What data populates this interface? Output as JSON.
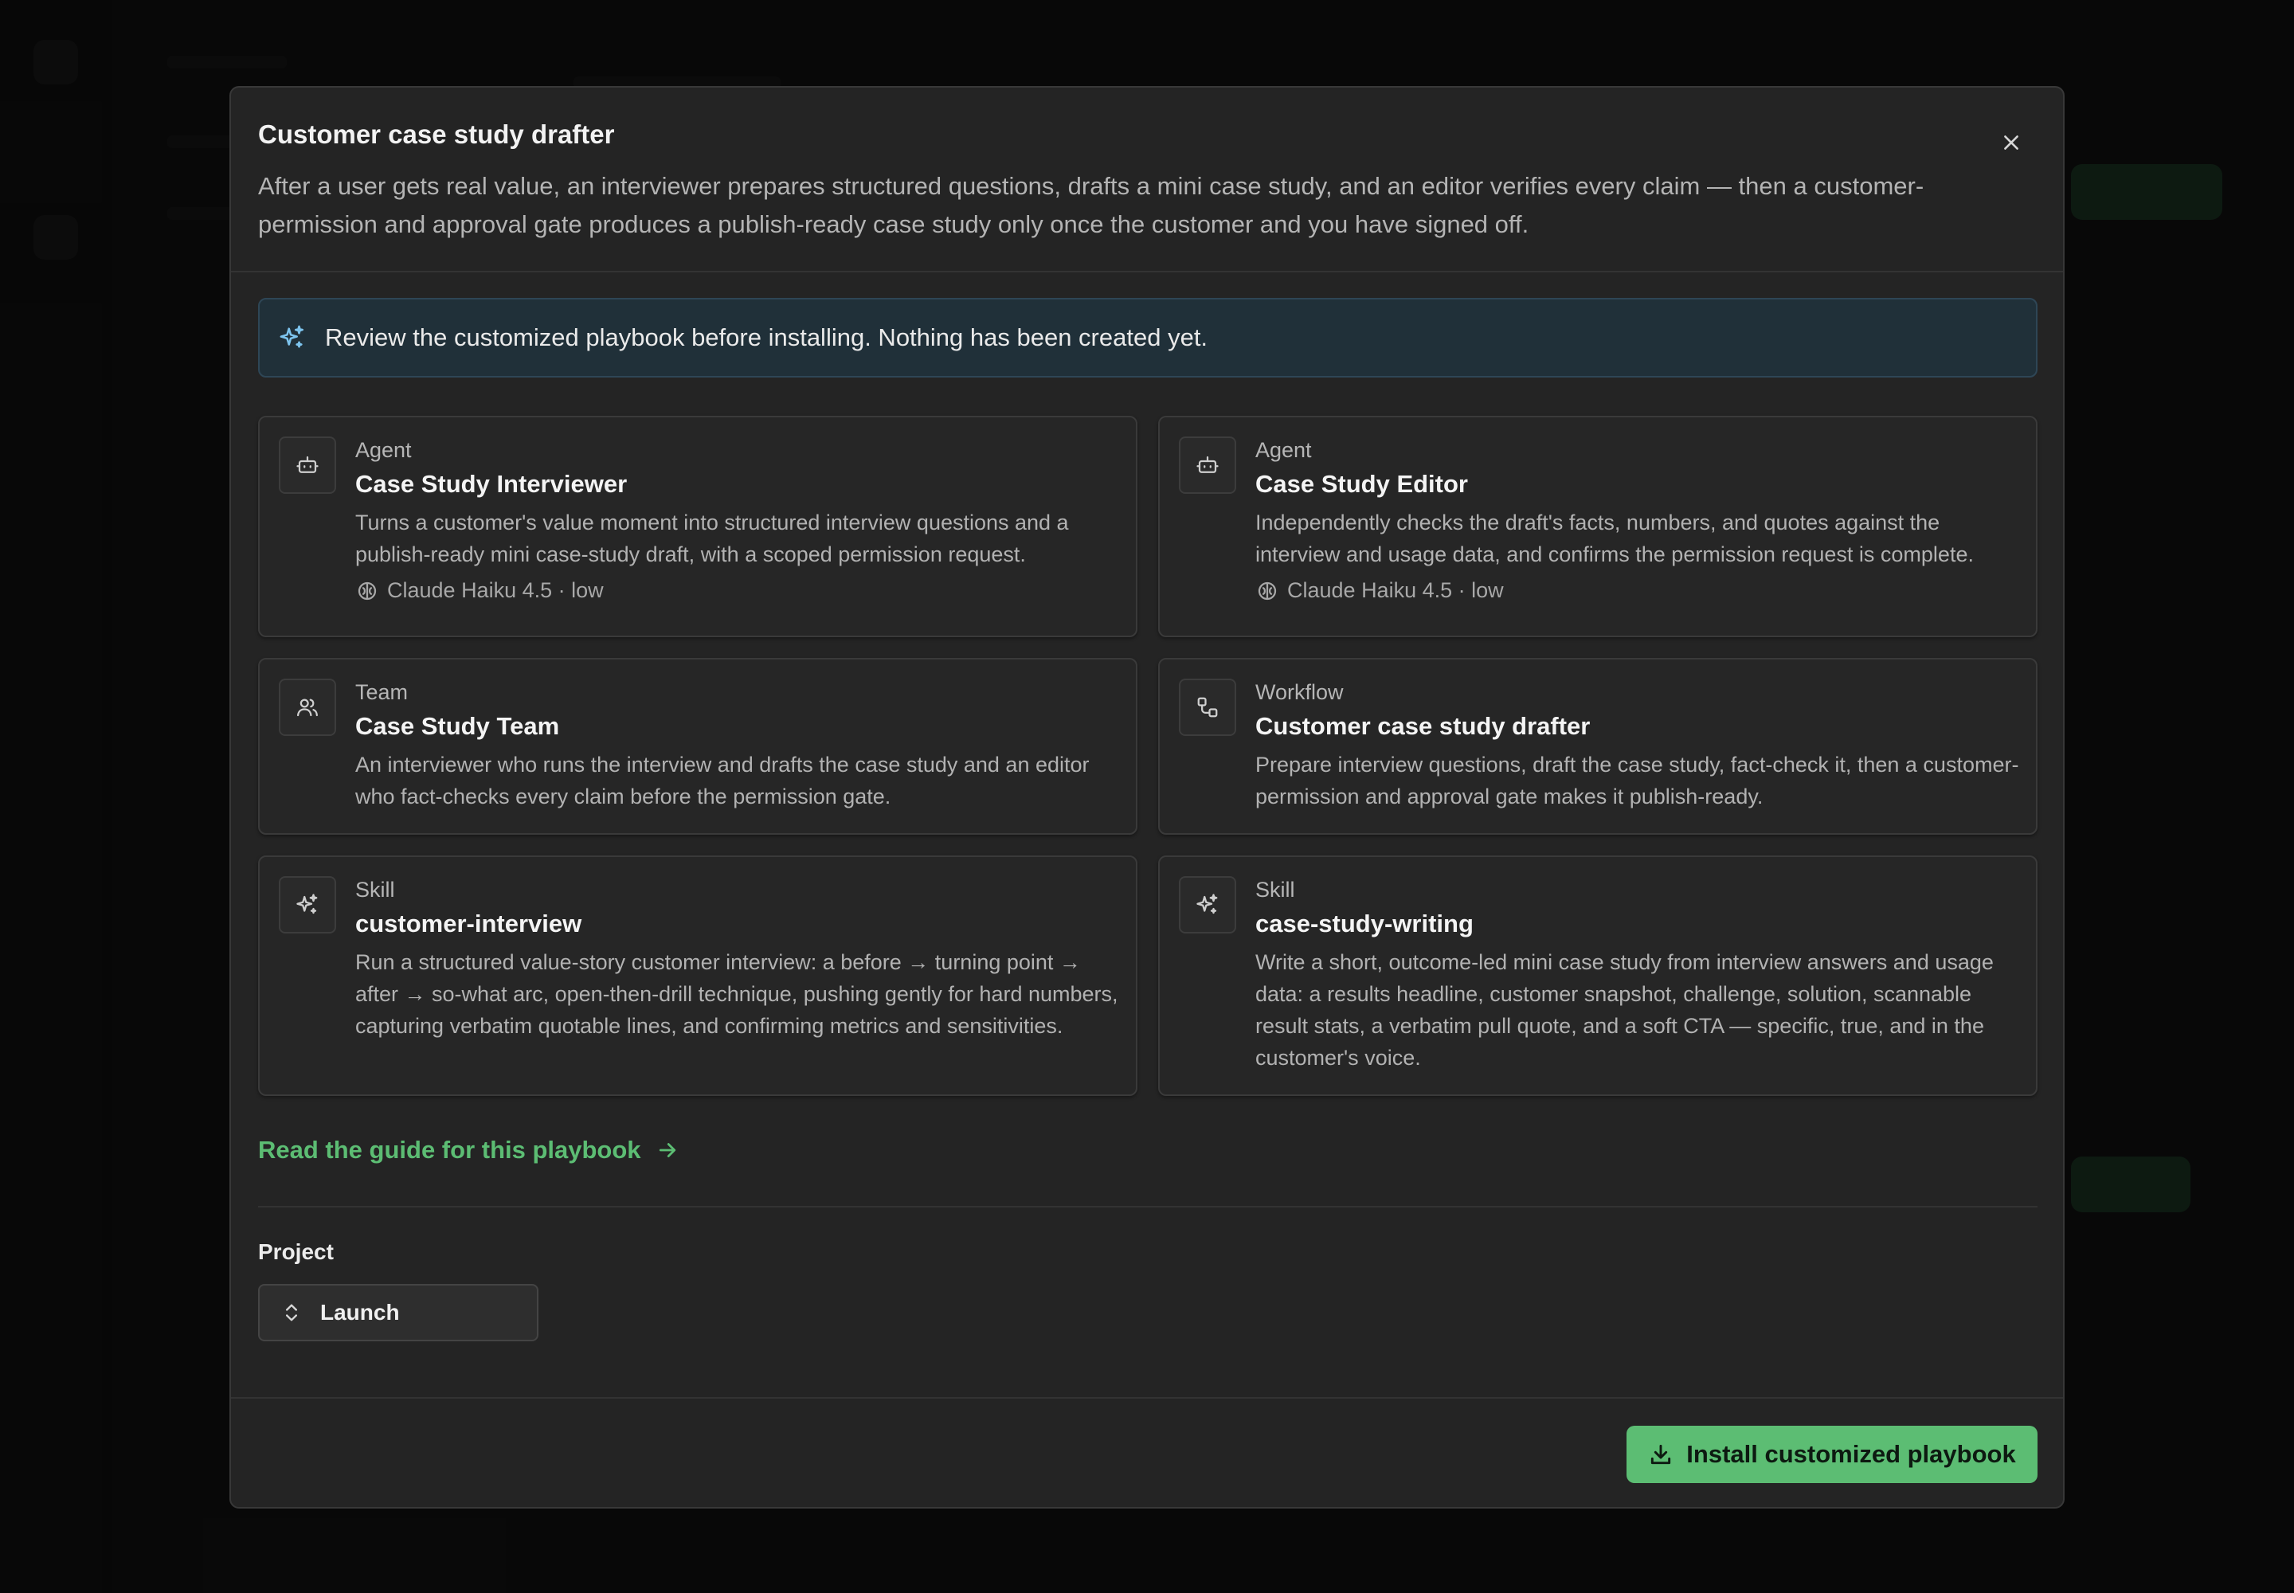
{
  "modal": {
    "title": "Customer case study drafter",
    "description": "After a user gets real value, an interviewer prepares structured questions, drafts a mini case study, and an editor verifies every claim — then a customer-permission and approval gate produces a publish-ready case study only once the customer and you have signed off.",
    "close_icon": "close-icon"
  },
  "notice": {
    "icon": "sparkles-icon",
    "text": "Review the customized playbook before installing. Nothing has been created yet."
  },
  "cards": [
    {
      "kind": "Agent",
      "name": "Case Study Interviewer",
      "description": "Turns a customer's value moment into structured interview questions and a publish-ready mini case-study draft, with a scoped permission request.",
      "model": "Claude Haiku 4.5 · low",
      "icon": "robot-icon"
    },
    {
      "kind": "Agent",
      "name": "Case Study Editor",
      "description": "Independently checks the draft's facts, numbers, and quotes against the interview and usage data, and confirms the permission request is complete.",
      "model": "Claude Haiku 4.5 · low",
      "icon": "robot-icon"
    },
    {
      "kind": "Team",
      "name": "Case Study Team",
      "description": "An interviewer who runs the interview and drafts the case study and an editor who fact-checks every claim before the permission gate.",
      "icon": "users-icon"
    },
    {
      "kind": "Workflow",
      "name": "Customer case study drafter",
      "description": "Prepare interview questions, draft the case study, fact-check it, then a customer-permission and approval gate makes it publish-ready.",
      "icon": "workflow-icon"
    },
    {
      "kind": "Skill",
      "name": "customer-interview",
      "description": "Run a structured value-story customer interview: a before → turning point → after → so-what arc, open-then-drill technique, pushing gently for hard numbers, capturing verbatim quotable lines, and confirming metrics and sensitivities.",
      "icon": "sparkles-icon"
    },
    {
      "kind": "Skill",
      "name": "case-study-writing",
      "description": "Write a short, outcome-led mini case study from interview answers and usage data: a results headline, customer snapshot, challenge, solution, scannable result stats, a verbatim pull quote, and a soft CTA — specific, true, and in the customer's voice.",
      "icon": "sparkles-icon"
    }
  ],
  "guide_link": "Read the guide for this playbook",
  "project": {
    "label": "Project",
    "value": "Launch"
  },
  "install_button": "Install customized playbook",
  "colors": {
    "accent": "#5cbd73",
    "notice_bg": "#203039",
    "modal_bg": "#242424"
  }
}
